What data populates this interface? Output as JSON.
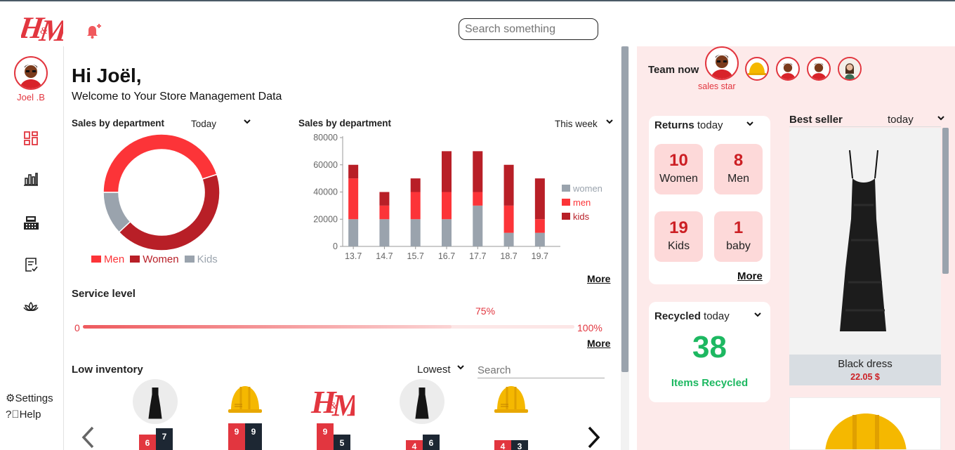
{
  "header": {
    "search_placeholder": "Search something",
    "brand_logo_text": "H&M"
  },
  "sidebar": {
    "user_name": "Joel .B",
    "nav": [
      "dashboard-icon",
      "chart-icon",
      "cash-register-icon",
      "checklist-icon",
      "lotus-icon"
    ],
    "settings_label": "Settings",
    "help_label": "Help"
  },
  "main": {
    "greeting": "Hi Joël,",
    "welcome": "Welcome to Your Store Management Data",
    "donut": {
      "title": "Sales by department",
      "period": "Today"
    },
    "bar": {
      "title": "Sales by department",
      "period": "This week",
      "more": "More"
    },
    "service": {
      "title": "Service level",
      "start": "0",
      "current": "75%",
      "end": "100%",
      "more": "More"
    },
    "inventory": {
      "title": "Low inventory",
      "sort": "Lowest",
      "search_placeholder": "Search",
      "items": [
        {
          "image": "black-dress",
          "a": "6",
          "b": "7"
        },
        {
          "image": "hard-hat",
          "a": "9",
          "b": "9"
        },
        {
          "image": "hm-logo",
          "a": "9",
          "b": "5"
        },
        {
          "image": "black-dress",
          "a": "4",
          "b": "6"
        },
        {
          "image": "hard-hat",
          "a": "4",
          "b": "3"
        }
      ]
    }
  },
  "team": {
    "title": "Team now",
    "star_label": "sales star"
  },
  "returns": {
    "title": "Returns",
    "period": "today",
    "stats": [
      {
        "value": "10",
        "label": "Women"
      },
      {
        "value": "8",
        "label": "Men"
      },
      {
        "value": "19",
        "label": "Kids"
      },
      {
        "value": "1",
        "label": "baby"
      }
    ],
    "more": "More"
  },
  "recycled": {
    "title": "Recycled",
    "period": "today",
    "value": "38",
    "label": "Items Recycled"
  },
  "best_seller": {
    "title": "Best seller",
    "period": "today",
    "name": "Black dress",
    "price": "22.05 $"
  },
  "colors": {
    "accent": "#e2363f",
    "dark_red": "#b81f27",
    "grey": "#9aa3ad",
    "green": "#1db861",
    "panel": "#fdeaea"
  },
  "chart_data": [
    {
      "type": "pie",
      "title": "Sales by department",
      "labels": [
        "Men",
        "Women",
        "Kids"
      ],
      "values": [
        45,
        43,
        12
      ],
      "colors": [
        "#fc3438",
        "#b81f27",
        "#9aa3ad"
      ],
      "legend": "bottom"
    },
    {
      "type": "bar",
      "stacked": true,
      "title": "Sales by department",
      "categories": [
        "13.7",
        "14.7",
        "15.7",
        "16.7",
        "17.7",
        "18.7",
        "19.7"
      ],
      "series": [
        {
          "name": "women",
          "values": [
            20000,
            20000,
            20000,
            20000,
            30000,
            10000,
            10000
          ]
        },
        {
          "name": "men",
          "values": [
            30000,
            10000,
            20000,
            20000,
            10000,
            20000,
            10000
          ]
        },
        {
          "name": "kids",
          "values": [
            10000,
            10000,
            10000,
            30000,
            30000,
            30000,
            30000
          ]
        }
      ],
      "ylim": [
        0,
        80000
      ],
      "yticks": [
        "0",
        "20000",
        "40000",
        "60000",
        "80000"
      ],
      "legend": "right"
    }
  ]
}
